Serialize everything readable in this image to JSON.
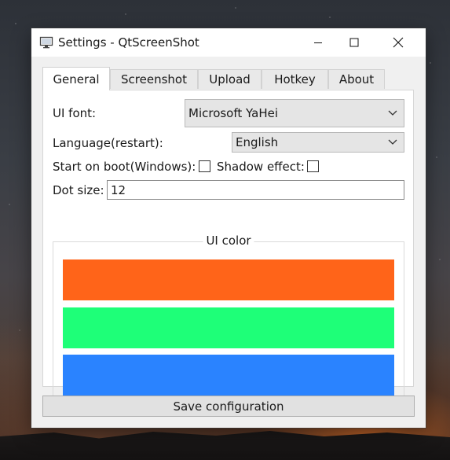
{
  "window": {
    "title": "Settings - QtScreenShot"
  },
  "tabs": [
    {
      "label": "General",
      "active": true
    },
    {
      "label": "Screenshot",
      "active": false
    },
    {
      "label": "Upload",
      "active": false
    },
    {
      "label": "Hotkey",
      "active": false
    },
    {
      "label": "About",
      "active": false
    }
  ],
  "general": {
    "ui_font_label": "UI font:",
    "ui_font_value": "Microsoft YaHei",
    "language_label": "Language(restart):",
    "language_value": "English",
    "start_on_boot_label": "Start on boot(Windows):",
    "start_on_boot_checked": false,
    "shadow_effect_label": "Shadow effect:",
    "shadow_effect_checked": false,
    "dot_size_label": "Dot size:",
    "dot_size_value": "12",
    "ui_color": {
      "title": "UI color",
      "colors": [
        "#ff6419",
        "#1eff78",
        "#2a83ff"
      ]
    }
  },
  "save_button_label": "Save configuration",
  "icons": {
    "app": "monitor-icon",
    "minimize": "minimize-icon",
    "maximize": "maximize-icon",
    "close": "close-icon",
    "dropdown": "chevron-down-icon"
  }
}
